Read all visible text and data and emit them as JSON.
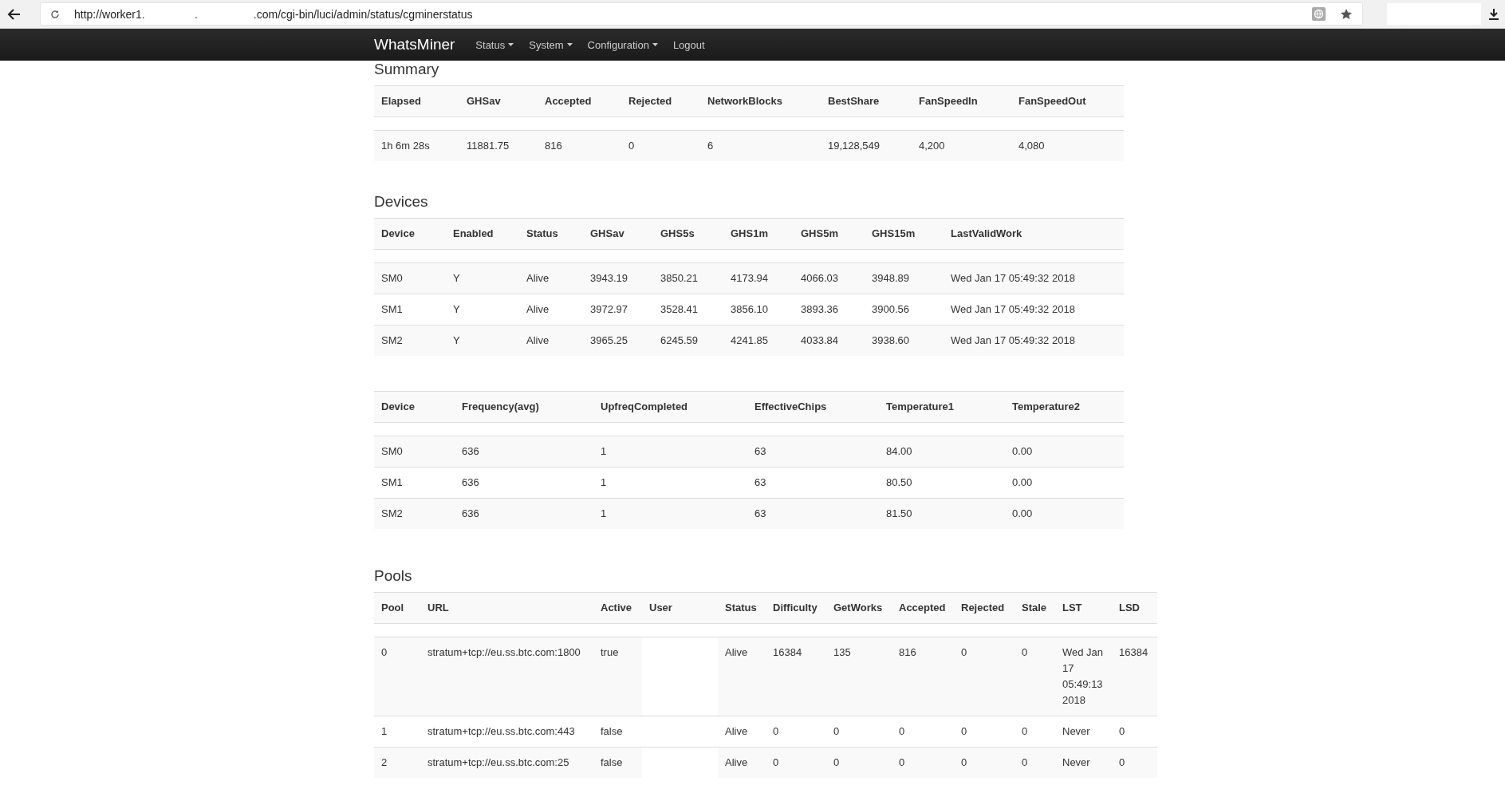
{
  "browser": {
    "url": "http://worker1.                .                  .com/cgi-bin/luci/admin/status/cgminerstatus"
  },
  "navbar": {
    "brand": "WhatsMiner",
    "menu": [
      {
        "label": "Status",
        "kind": "dropdown"
      },
      {
        "label": "System",
        "kind": "dropdown"
      },
      {
        "label": "Configuration",
        "kind": "dropdown"
      },
      {
        "label": "Logout",
        "kind": "link"
      }
    ]
  },
  "sections": [
    {
      "title": "Summary",
      "tables": [
        {
          "columns": [
            "Elapsed",
            "GHSav",
            "Accepted",
            "Rejected",
            "NetworkBlocks",
            "BestShare",
            "FanSpeedIn",
            "FanSpeedOut"
          ],
          "rows": [
            [
              "1h 6m 28s",
              "11881.75",
              "816",
              "0",
              "6",
              "19,128,549",
              "4,200",
              "4,080"
            ]
          ]
        }
      ]
    },
    {
      "title": "Devices",
      "tables": [
        {
          "columns": [
            "Device",
            "Enabled",
            "Status",
            "GHSav",
            "GHS5s",
            "GHS1m",
            "GHS5m",
            "GHS15m",
            "LastValidWork"
          ],
          "rows": [
            [
              "SM0",
              "Y",
              "Alive",
              "3943.19",
              "3850.21",
              "4173.94",
              "4066.03",
              "3948.89",
              "Wed Jan 17 05:49:32 2018"
            ],
            [
              "SM1",
              "Y",
              "Alive",
              "3972.97",
              "3528.41",
              "3856.10",
              "3893.36",
              "3900.56",
              "Wed Jan 17 05:49:32 2018"
            ],
            [
              "SM2",
              "Y",
              "Alive",
              "3965.25",
              "6245.59",
              "4241.85",
              "4033.84",
              "3938.60",
              "Wed Jan 17 05:49:32 2018"
            ]
          ]
        },
        {
          "columns": [
            "Device",
            "Frequency(avg)",
            "UpfreqCompleted",
            "EffectiveChips",
            "Temperature1",
            "Temperature2"
          ],
          "rows": [
            [
              "SM0",
              "636",
              "1",
              "63",
              "84.00",
              "0.00"
            ],
            [
              "SM1",
              "636",
              "1",
              "63",
              "80.50",
              "0.00"
            ],
            [
              "SM2",
              "636",
              "1",
              "63",
              "81.50",
              "0.00"
            ]
          ]
        }
      ]
    },
    {
      "title": "Pools",
      "tables": [
        {
          "columns": [
            {
              "label": "Pool",
              "kind": "text"
            },
            {
              "label": "URL",
              "kind": "text"
            },
            {
              "label": "Active",
              "kind": "text"
            },
            {
              "label": "User",
              "kind": "blank"
            },
            {
              "label": "Status",
              "kind": "text"
            },
            {
              "label": "Difficulty",
              "kind": "text"
            },
            {
              "label": "GetWorks",
              "kind": "text"
            },
            {
              "label": "Accepted",
              "kind": "text"
            },
            {
              "label": "Rejected",
              "kind": "text"
            },
            {
              "label": "Stale",
              "kind": "text"
            },
            {
              "label": "LST",
              "kind": "text"
            },
            {
              "label": "LSD",
              "kind": "text"
            }
          ],
          "rows": [
            [
              "0",
              "stratum+tcp://eu.ss.btc.com:1800",
              "true",
              "",
              "Alive",
              "16384",
              "135",
              "816",
              "0",
              "0",
              "Wed Jan 17 05:49:13 2018",
              "16384"
            ],
            [
              "1",
              "stratum+tcp://eu.ss.btc.com:443",
              "false",
              "",
              "Alive",
              "0",
              "0",
              "0",
              "0",
              "0",
              "Never",
              "0"
            ],
            [
              "2",
              "stratum+tcp://eu.ss.btc.com:25",
              "false",
              "",
              "Alive",
              "0",
              "0",
              "0",
              "0",
              "0",
              "Never",
              "0"
            ]
          ]
        }
      ]
    }
  ]
}
